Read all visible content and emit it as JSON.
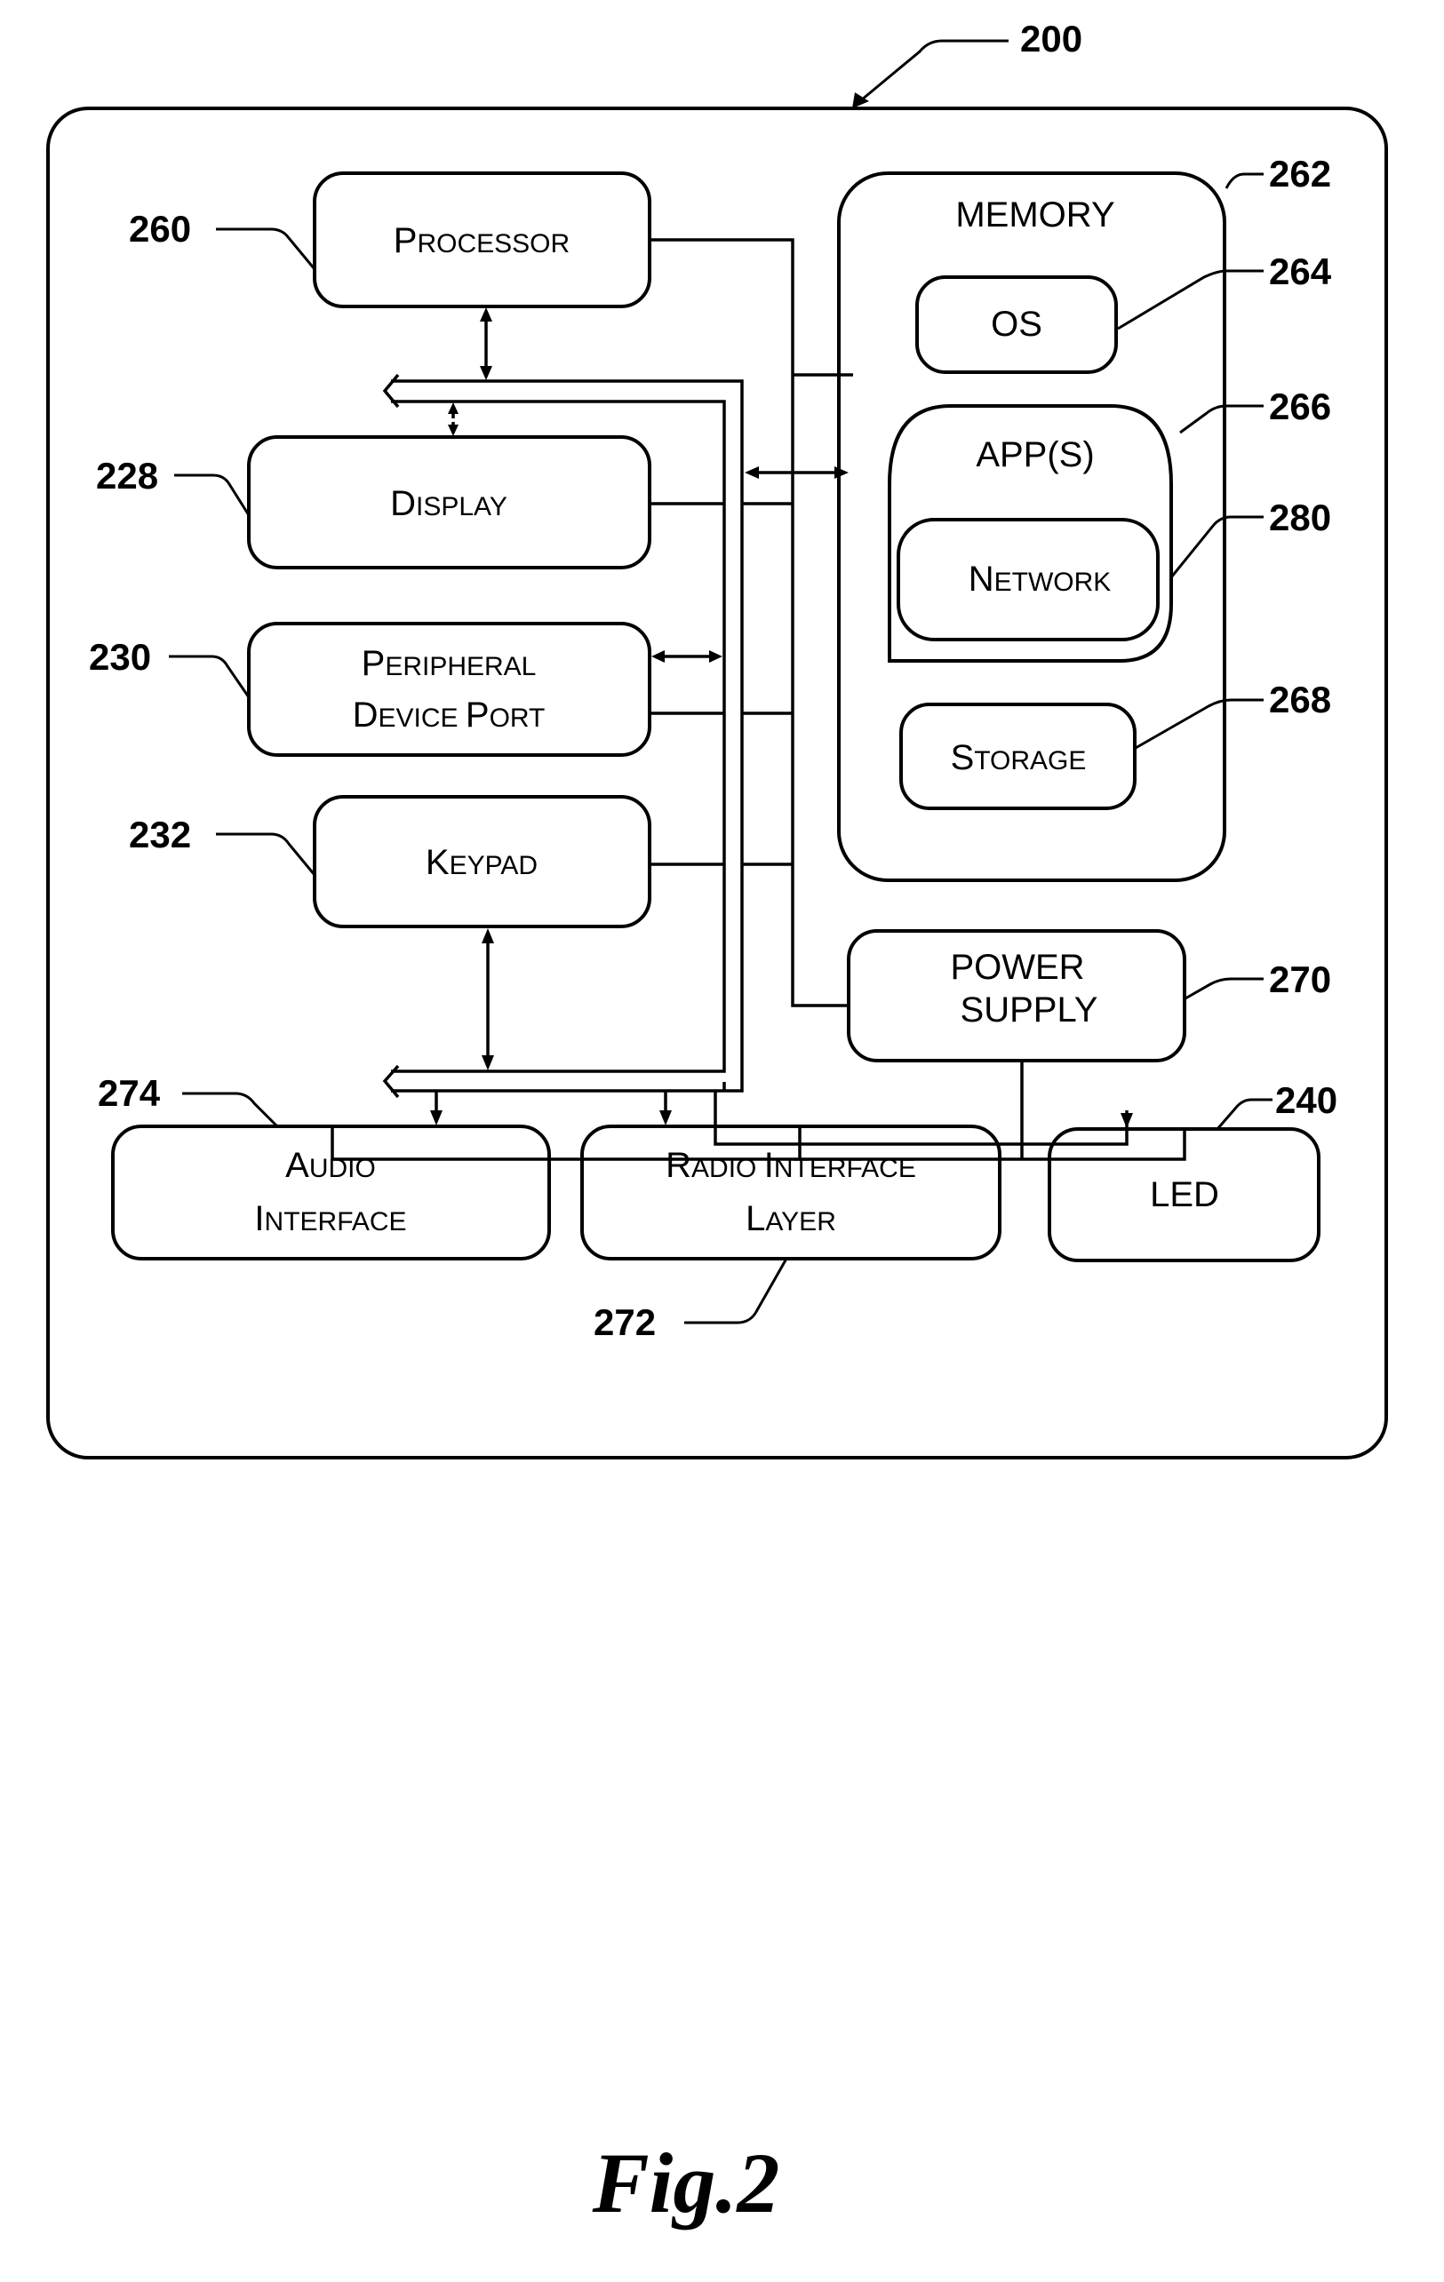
{
  "figure": {
    "caption": "Fig.2",
    "device_ref": "200"
  },
  "blocks": {
    "processor": {
      "ref": "260",
      "label_first": "P",
      "label_rest": "ROCESSOR"
    },
    "display": {
      "ref": "228",
      "label_first": "D",
      "label_rest": "ISPLAY"
    },
    "peripheral": {
      "ref": "230",
      "line1_first": "P",
      "line1_rest": "ERIPHERAL",
      "line2_first": "D",
      "line2_mid": "EVICE ",
      "line2_first2": "P",
      "line2_rest": "ORT"
    },
    "keypad": {
      "ref": "232",
      "label_first": "K",
      "label_rest": "EYPAD"
    },
    "memory": {
      "ref": "262",
      "label": "MEMORY"
    },
    "os": {
      "ref": "264",
      "label": "OS"
    },
    "apps": {
      "ref": "266",
      "label": "APP(S)"
    },
    "network": {
      "ref": "280",
      "label_first": "N",
      "label_rest": "ETWORK"
    },
    "storage": {
      "ref": "268",
      "label_first": "S",
      "label_rest": "TORAGE"
    },
    "power_supply": {
      "ref": "270",
      "line1": "POWER",
      "line2": "SUPPLY"
    },
    "audio_interface": {
      "ref": "274",
      "line1_first": "A",
      "line1_rest": "UDIO",
      "line2_first": "I",
      "line2_rest": "NTERFACE"
    },
    "radio_interface_layer": {
      "ref": "272",
      "line1_first": "R",
      "line1_mid": "ADIO ",
      "line1_first2": "I",
      "line1_rest": "NTERFACE",
      "line2_first": "L",
      "line2_rest": "AYER"
    },
    "led": {
      "ref": "240",
      "label": "LED"
    }
  }
}
